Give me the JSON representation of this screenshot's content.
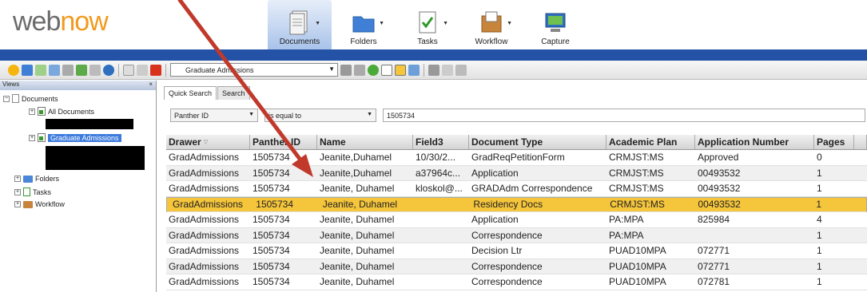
{
  "logo": {
    "part1": "web",
    "part2": "now"
  },
  "nav": [
    {
      "label": "Documents",
      "icon": "documents-icon"
    },
    {
      "label": "Folders",
      "icon": "folders-icon"
    },
    {
      "label": "Tasks",
      "icon": "tasks-icon"
    },
    {
      "label": "Workflow",
      "icon": "workflow-icon"
    },
    {
      "label": "Capture",
      "icon": "capture-icon"
    }
  ],
  "toolbar": {
    "view_select": "Graduate Admissions"
  },
  "views": {
    "header": "Views",
    "tree": {
      "documents": "Documents",
      "all_documents": "All Documents",
      "graduate_admissions": "Graduate Admissions",
      "folders": "Folders",
      "tasks": "Tasks",
      "workflow": "Workflow"
    }
  },
  "tabs": [
    "Quick Search",
    "Search"
  ],
  "search": {
    "field": "Panther ID",
    "operator": "is equal to",
    "value": "1505734"
  },
  "grid": {
    "columns": [
      "Drawer",
      "Panther ID",
      "Name",
      "Field3",
      "Document Type",
      "Academic Plan",
      "Application Number",
      "Pages",
      ""
    ],
    "rows": [
      [
        "GradAdmissions",
        "1505734",
        "Jeanite,Duhamel",
        "10/30/2...",
        "GradReqPetitionForm",
        "CRMJST:MS",
        "Approved",
        "0",
        ""
      ],
      [
        "GradAdmissions",
        "1505734",
        "Jeanite,Duhamel",
        "a37964c...",
        "Application",
        "CRMJST:MS",
        "00493532",
        "1",
        ""
      ],
      [
        "GradAdmissions",
        "1505734",
        "Jeanite, Duhamel",
        "kloskol@...",
        "GRADAdm Correspondence",
        "CRMJST:MS",
        "00493532",
        "1",
        ""
      ],
      [
        "GradAdmissions",
        "1505734",
        "Jeanite, Duhamel",
        "",
        "Residency Docs",
        "CRMJST:MS",
        "00493532",
        "1",
        ""
      ],
      [
        "GradAdmissions",
        "1505734",
        "Jeanite, Duhamel",
        "",
        "Application",
        "PA:MPA",
        "825984",
        "4",
        ""
      ],
      [
        "GradAdmissions",
        "1505734",
        "Jeanite, Duhamel",
        "",
        "Correspondence",
        "PA:MPA",
        "",
        "1",
        ""
      ],
      [
        "GradAdmissions",
        "1505734",
        "Jeanite, Duhamel",
        "",
        "Decision Ltr",
        "PUAD10MPA",
        "072771",
        "1",
        ""
      ],
      [
        "GradAdmissions",
        "1505734",
        "Jeanite, Duhamel",
        "",
        "Correspondence",
        "PUAD10MPA",
        "072771",
        "1",
        ""
      ],
      [
        "GradAdmissions",
        "1505734",
        "Jeanite, Duhamel",
        "",
        "Correspondence",
        "PUAD10MPA",
        "072781",
        "1",
        ""
      ]
    ],
    "selected_row": 3
  },
  "colors": {
    "accent_bar": "#2452a6",
    "selected_row": "#f5c53c",
    "arrow": "#c0392b"
  }
}
